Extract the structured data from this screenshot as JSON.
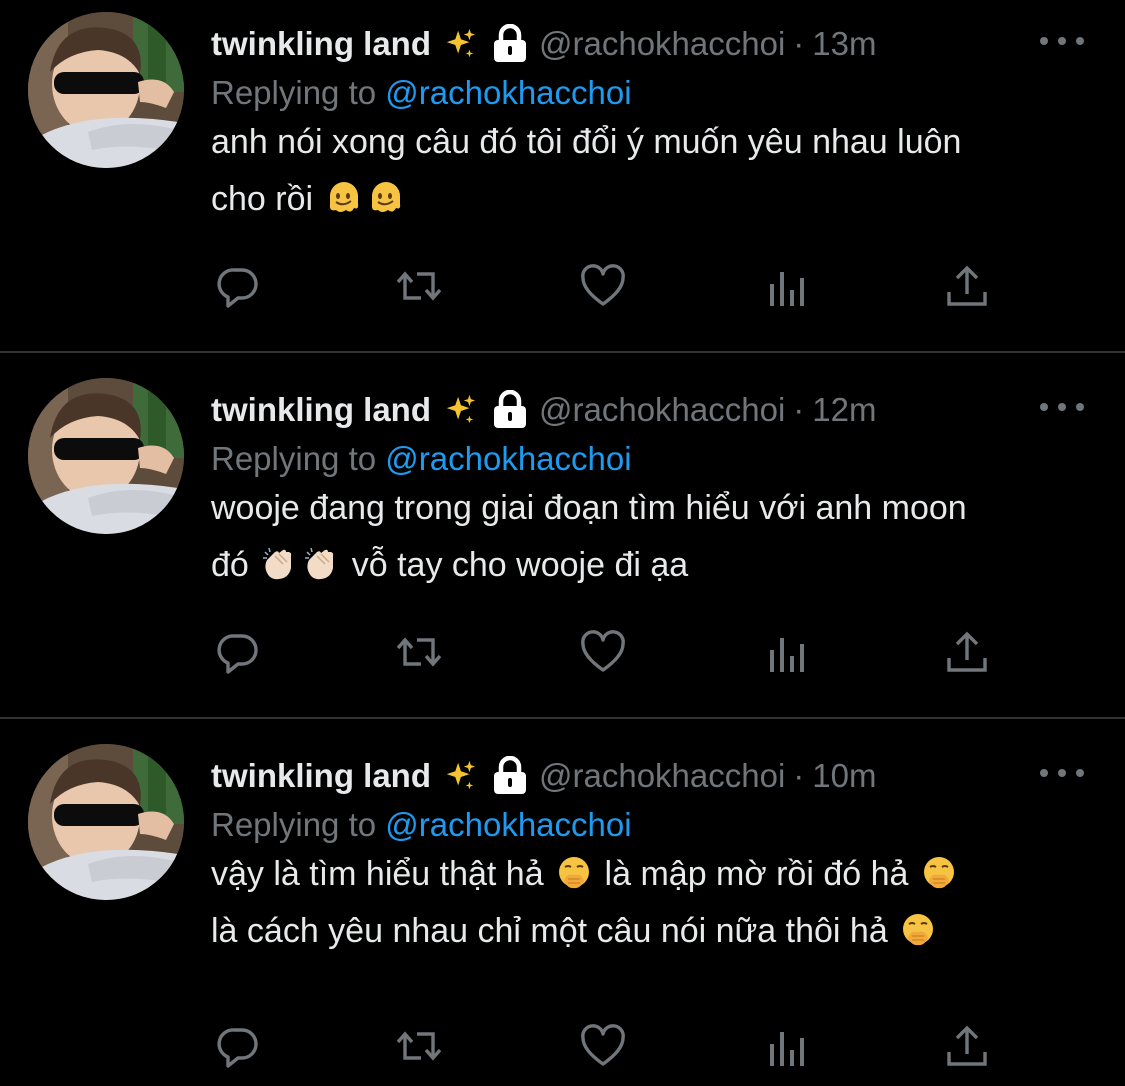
{
  "colors": {
    "background": "#000000",
    "text": "#e7e9ea",
    "muted": "#71767b",
    "link": "#1d9bf0",
    "divider": "#2f3336"
  },
  "tweets": [
    {
      "display_name": "twinkling land",
      "name_emoji": "sparkles-icon",
      "locked": "lock-icon",
      "handle": "@rachokhacchoi",
      "separator": "·",
      "time": "13m",
      "replying_prefix": "Replying to",
      "replying_to": "@rachokhacchoi",
      "text_line1": "anh nói xong câu đó tôi đổi ý muốn yêu nhau luôn",
      "text_line2": "cho rồi",
      "line2_emojis": [
        "melting-face-icon",
        "melting-face-icon"
      ]
    },
    {
      "display_name": "twinkling land",
      "name_emoji": "sparkles-icon",
      "locked": "lock-icon",
      "handle": "@rachokhacchoi",
      "separator": "·",
      "time": "12m",
      "replying_prefix": "Replying to",
      "replying_to": "@rachokhacchoi",
      "text_line1": "wooje đang trong giai đoạn tìm hiểu với anh moon",
      "text_line2a": "đó",
      "text_line2b": "vỗ tay cho wooje đi ạa",
      "line2_emojis": [
        "clapping-hands-icon",
        "clapping-hands-icon"
      ]
    },
    {
      "display_name": "twinkling land",
      "name_emoji": "sparkles-icon",
      "locked": "lock-icon",
      "handle": "@rachokhacchoi",
      "separator": "·",
      "time": "10m",
      "replying_prefix": "Replying to",
      "replying_to": "@rachokhacchoi",
      "text_line1a": "vậy là tìm hiểu thật hả",
      "text_line1b": "là mập mờ rồi đó hả",
      "text_line2": "là cách yêu nhau chỉ một câu nói nữa thôi hả",
      "line_emojis": [
        "face-with-hand-over-mouth-icon",
        "face-with-hand-over-mouth-icon",
        "face-with-hand-over-mouth-icon"
      ]
    }
  ],
  "actions": [
    "reply-icon",
    "retweet-icon",
    "like-icon",
    "analytics-icon",
    "share-icon"
  ]
}
